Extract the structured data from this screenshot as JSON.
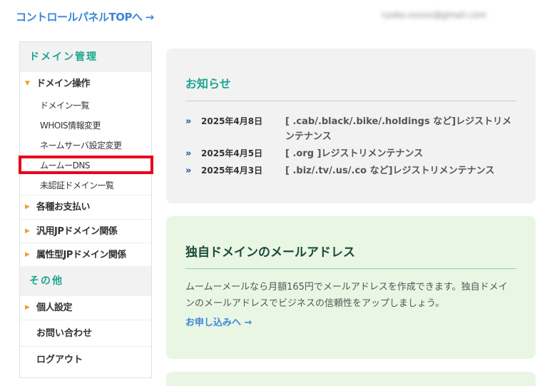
{
  "header": {
    "top_link": "コントロールパネルTOPへ",
    "top_link_arrow": "→",
    "user_email": "ryoko.xxxxx@gmail.com"
  },
  "sidebar": {
    "domain_section": "ドメイン管理",
    "domain_ops": {
      "label": "ドメイン操作",
      "items": [
        "ドメイン一覧",
        "WHOIS情報変更",
        "ネームサーバ設定変更",
        "ムームーDNS",
        "未認証ドメイン一覧"
      ]
    },
    "payments": "各種お支払い",
    "jp_domain": "汎用JPドメイン関係",
    "attr_jp_domain": "属性型JPドメイン関係",
    "other_section": "その他",
    "personal_settings": "個人設定",
    "contact": "お問い合わせ",
    "logout": "ログアウト"
  },
  "news": {
    "title": "お知らせ",
    "bullet": "»",
    "items": [
      {
        "date": "2025年4月8日",
        "text": "[ .cab/.black/.bike/.holdings など]レジストリメンテナンス"
      },
      {
        "date": "2025年4月5日",
        "text": "[ .org ]レジストリメンテナンス"
      },
      {
        "date": "2025年4月3日",
        "text": "[ .biz/.tv/.us/.co など]レジストリメンテナンス"
      }
    ]
  },
  "mail": {
    "title": "独自ドメインのメールアドレス",
    "body": "ムームーメールなら月額165円でメールアドレスを作成できます。独自ドメインのメールアドレスでビジネスの信頼性をアップしましょう。",
    "link": "お申し込みへ →"
  },
  "colors": {
    "accent": "#1aa68f",
    "link": "#3a86d8",
    "highlight": "#e8001c",
    "triangle": "#f0a030"
  },
  "icons": {
    "expanded": "triangle-down-icon",
    "collapsed": "triangle-right-icon",
    "news_bullet": "double-chevron-icon"
  }
}
